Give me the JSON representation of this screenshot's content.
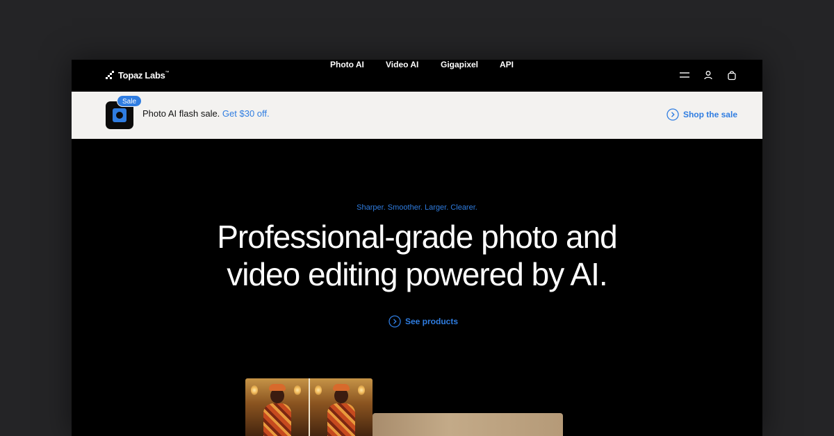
{
  "nav": {
    "logo_text": "Topaz Labs",
    "logo_tm": "™",
    "links": [
      "Photo AI",
      "Video AI",
      "Gigapixel",
      "API"
    ],
    "icons": [
      "menu-icon",
      "account-icon",
      "cart-icon"
    ]
  },
  "banner": {
    "badge": "Sale",
    "text": "Photo AI flash sale.",
    "link": "Get $30 off.",
    "cta": "Shop the sale"
  },
  "hero": {
    "eyebrow": "Sharper. Smoother. Larger. Clearer.",
    "headline_line1": "Professional-grade photo and",
    "headline_line2": "video editing powered by AI.",
    "cta": "See products"
  },
  "colors": {
    "accent": "#2f7de1",
    "background": "#000000",
    "banner_bg": "#f3f2f0",
    "page_bg": "#242426"
  }
}
